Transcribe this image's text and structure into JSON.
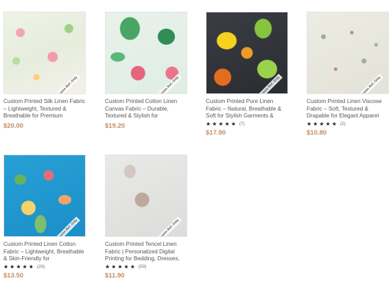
{
  "products": [
    {
      "title": "Custom Printed Silk Linen Fabric – Lightweight, Textured & Breathable for Premium",
      "price": "$20.00",
      "tag": "Passion Ref. Only",
      "rating": null
    },
    {
      "title": "Custom Printed Cotton Linen Canvas Fabric – Durable, Textured & Stylish for",
      "price": "$19.20",
      "tag": "Passion Ref. Only",
      "rating": null
    },
    {
      "title": "Custom Printed Pure Linen Fabric – Natural, Breathable & Soft for Stylish Garments &",
      "price": "$17.90",
      "tag": "Passion Ref. Only",
      "rating": {
        "stars": 5,
        "count": "(7)"
      }
    },
    {
      "title": "Custom Printed Linen Viscose Fabric – Soft, Textured & Drapable for Elegant Apparel",
      "price": "$10.80",
      "tag": "Passion Ref. Only",
      "rating": {
        "stars": 5,
        "count": "(2)"
      }
    },
    {
      "title": "Custom Printed Linen Cotton Fabric – Lightweight, Breathable & Skin-Friendly for",
      "price": "$13.50",
      "tag": "Passion Ref. Only",
      "rating": {
        "stars": 5,
        "count": "(20)"
      }
    },
    {
      "title": "Custom Printed Tencel Linen Fabric | Personalized Digital Printing for Bedding, Dresses,",
      "price": "$11.90",
      "tag": "Passion Ref. Only",
      "rating": {
        "stars": 5,
        "count": "(50)"
      }
    }
  ],
  "star_glyph": "★",
  "colors": {
    "price": "#c88b60",
    "star": "#222222"
  }
}
